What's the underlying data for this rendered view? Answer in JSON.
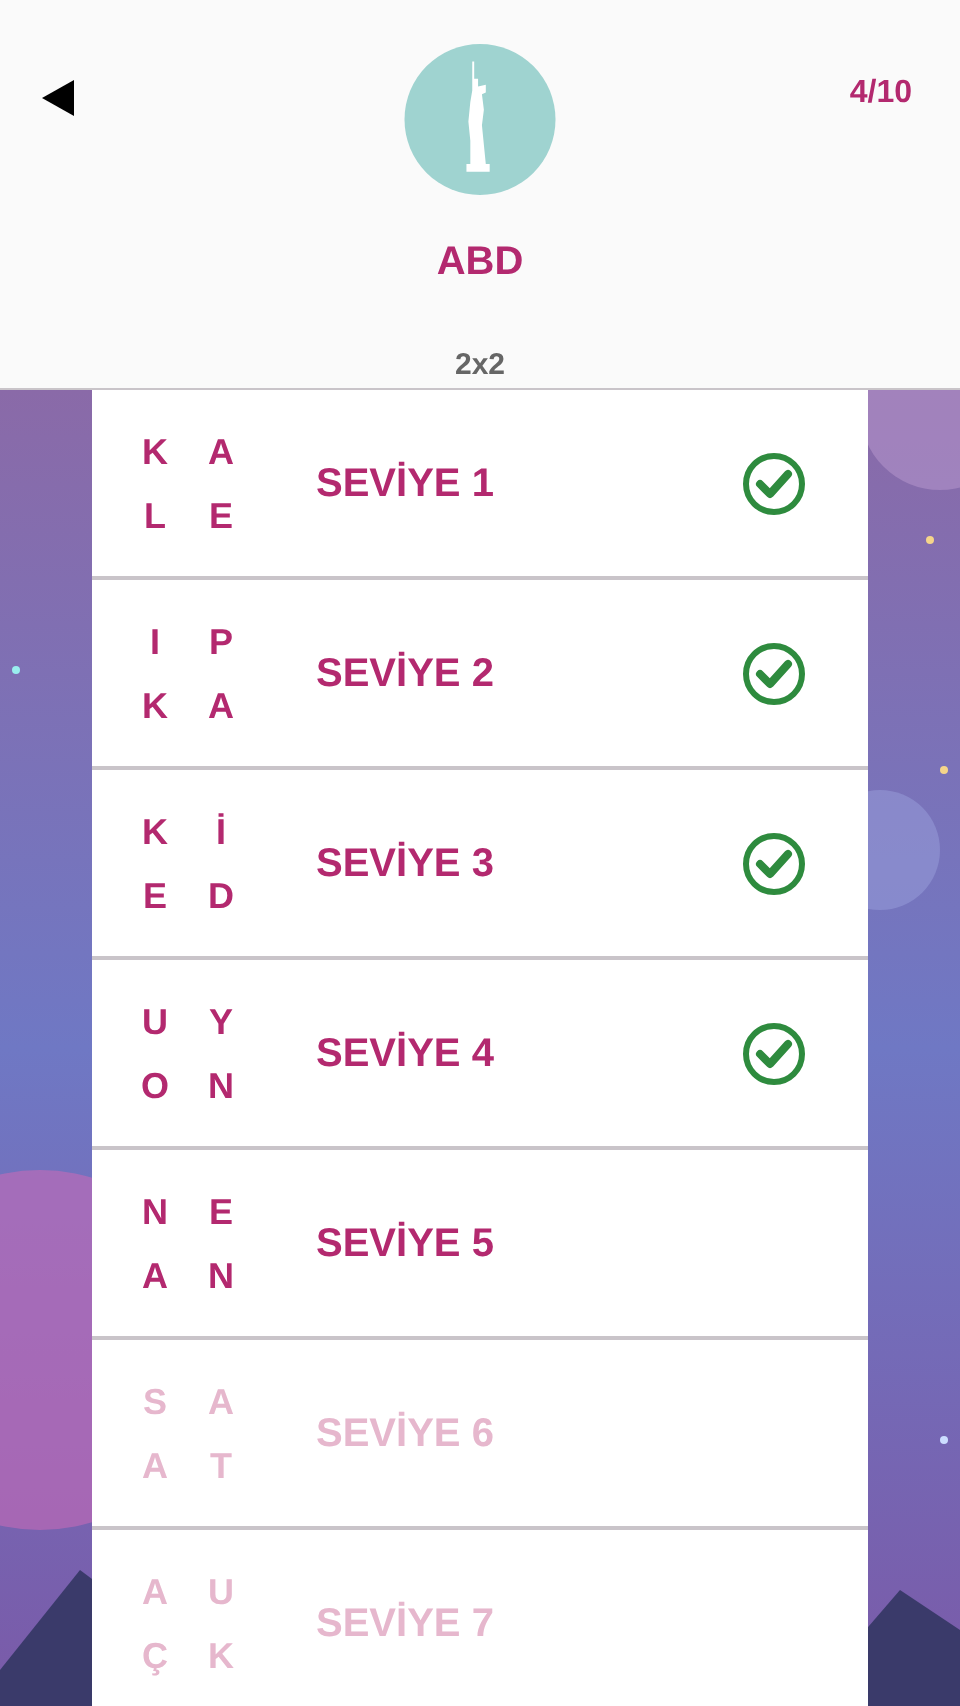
{
  "header": {
    "title": "ABD",
    "progress": "4/10",
    "grid_size": "2x2"
  },
  "levels": [
    {
      "letters": [
        "K",
        "A",
        "L",
        "E"
      ],
      "title": "SEVİYE 1",
      "completed": true,
      "locked": false
    },
    {
      "letters": [
        "I",
        "P",
        "K",
        "A"
      ],
      "title": "SEVİYE 2",
      "completed": true,
      "locked": false
    },
    {
      "letters": [
        "K",
        "İ",
        "E",
        "D"
      ],
      "title": "SEVİYE 3",
      "completed": true,
      "locked": false
    },
    {
      "letters": [
        "U",
        "Y",
        "O",
        "N"
      ],
      "title": "SEVİYE 4",
      "completed": true,
      "locked": false
    },
    {
      "letters": [
        "N",
        "E",
        "A",
        "N"
      ],
      "title": "SEVİYE 5",
      "completed": false,
      "locked": false
    },
    {
      "letters": [
        "S",
        "A",
        "A",
        "T"
      ],
      "title": "SEVİYE 6",
      "completed": false,
      "locked": true
    },
    {
      "letters": [
        "A",
        "U",
        "Ç",
        "K"
      ],
      "title": "SEVİYE 7",
      "completed": false,
      "locked": true
    }
  ]
}
